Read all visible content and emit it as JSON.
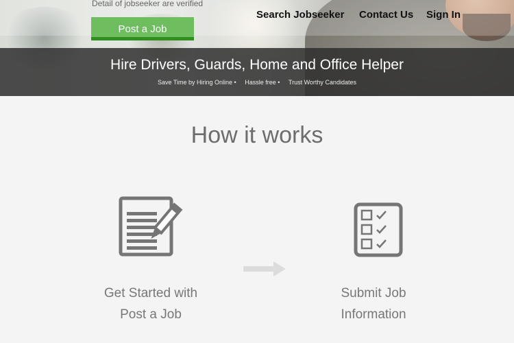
{
  "header": {
    "description": "Detail of jobseeker are verified",
    "post_job_label": "Post a Job",
    "nav": [
      {
        "label": "Search Jobseeker"
      },
      {
        "label": "Contact Us"
      },
      {
        "label": "Sign In"
      }
    ]
  },
  "banner": {
    "title": "Hire Drivers, Guards, Home and Office Helper",
    "taglines": [
      "Save Time by Hiring Online •",
      "Hassle free •",
      "Trust Worthy Candidates"
    ]
  },
  "how_it_works": {
    "title": "How it works",
    "steps": [
      {
        "line1": "Get Started with",
        "line2": "Post a Job",
        "icon": "document-edit-icon"
      },
      {
        "line1": "Submit Job",
        "line2": "Information",
        "icon": "checklist-icon"
      }
    ],
    "arrow_icon": "arrow-right-icon"
  },
  "colors": {
    "post_button": "#6ebd5e",
    "post_button_border": "#2f8f1f",
    "banner_bg": "#2d2d2d",
    "icon_gray": "#757575",
    "page_bg": "#f4f4f4"
  }
}
